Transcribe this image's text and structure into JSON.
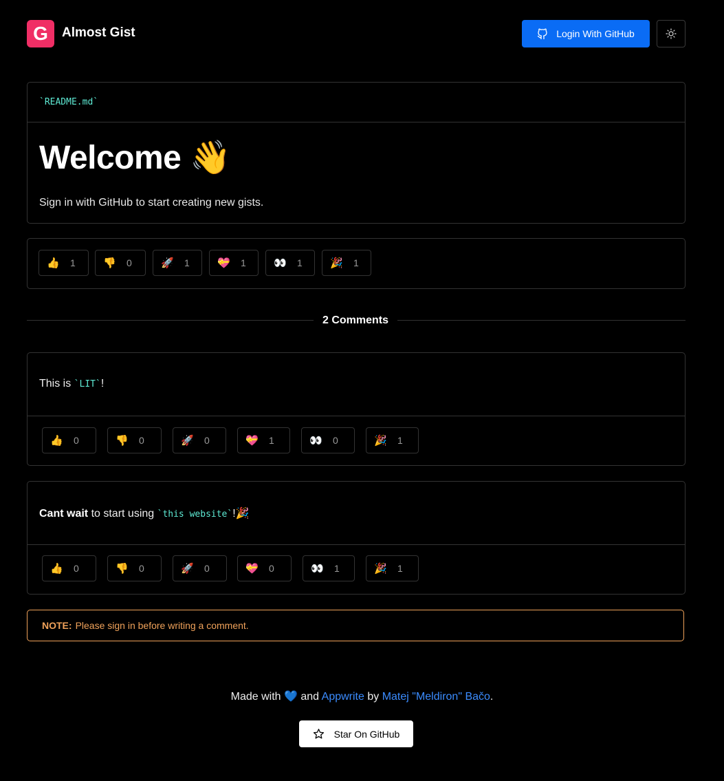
{
  "header": {
    "logo_letter": "G",
    "app_title": "Almost Gist",
    "login_label": "Login With GitHub",
    "theme_icon": "sun-icon",
    "accent": "#f02e65",
    "login_color": "#0a6cf5"
  },
  "readme": {
    "filename": "`README.md`",
    "heading": "Welcome 👋",
    "text": "Sign in with GitHub to start creating new gists.",
    "reactions": [
      {
        "emoji": "👍",
        "count": "1"
      },
      {
        "emoji": "👎",
        "count": "0"
      },
      {
        "emoji": "🚀",
        "count": "1"
      },
      {
        "emoji": "💝",
        "count": "1"
      },
      {
        "emoji": "👀",
        "count": "1"
      },
      {
        "emoji": "🎉",
        "count": "1"
      }
    ]
  },
  "comments_title": "2 Comments",
  "comments": [
    {
      "text_before": "This is ",
      "code": "`LIT`",
      "text_after": "!",
      "reactions": [
        {
          "emoji": "👍",
          "count": "0"
        },
        {
          "emoji": "👎",
          "count": "0"
        },
        {
          "emoji": "🚀",
          "count": "0"
        },
        {
          "emoji": "💝",
          "count": "1"
        },
        {
          "emoji": "👀",
          "count": "0"
        },
        {
          "emoji": "🎉",
          "count": "1"
        }
      ]
    },
    {
      "bold": "Cant wait",
      "text_before": " to start using ",
      "code": "`this website`",
      "text_after": "!🎉",
      "reactions": [
        {
          "emoji": "👍",
          "count": "0"
        },
        {
          "emoji": "👎",
          "count": "0"
        },
        {
          "emoji": "🚀",
          "count": "0"
        },
        {
          "emoji": "💝",
          "count": "0"
        },
        {
          "emoji": "👀",
          "count": "1"
        },
        {
          "emoji": "🎉",
          "count": "1"
        }
      ]
    }
  ],
  "note": {
    "label": "NOTE:",
    "text": "Please sign in before writing a comment.",
    "color": "#f0a25a"
  },
  "footer": {
    "made_with": "Made with",
    "heart": "💙",
    "and": "and",
    "appwrite": "Appwrite",
    "by": "by",
    "author": "Matej \"Meldiron\" Bačo",
    "period": ".",
    "star_label": "Star On GitHub"
  }
}
